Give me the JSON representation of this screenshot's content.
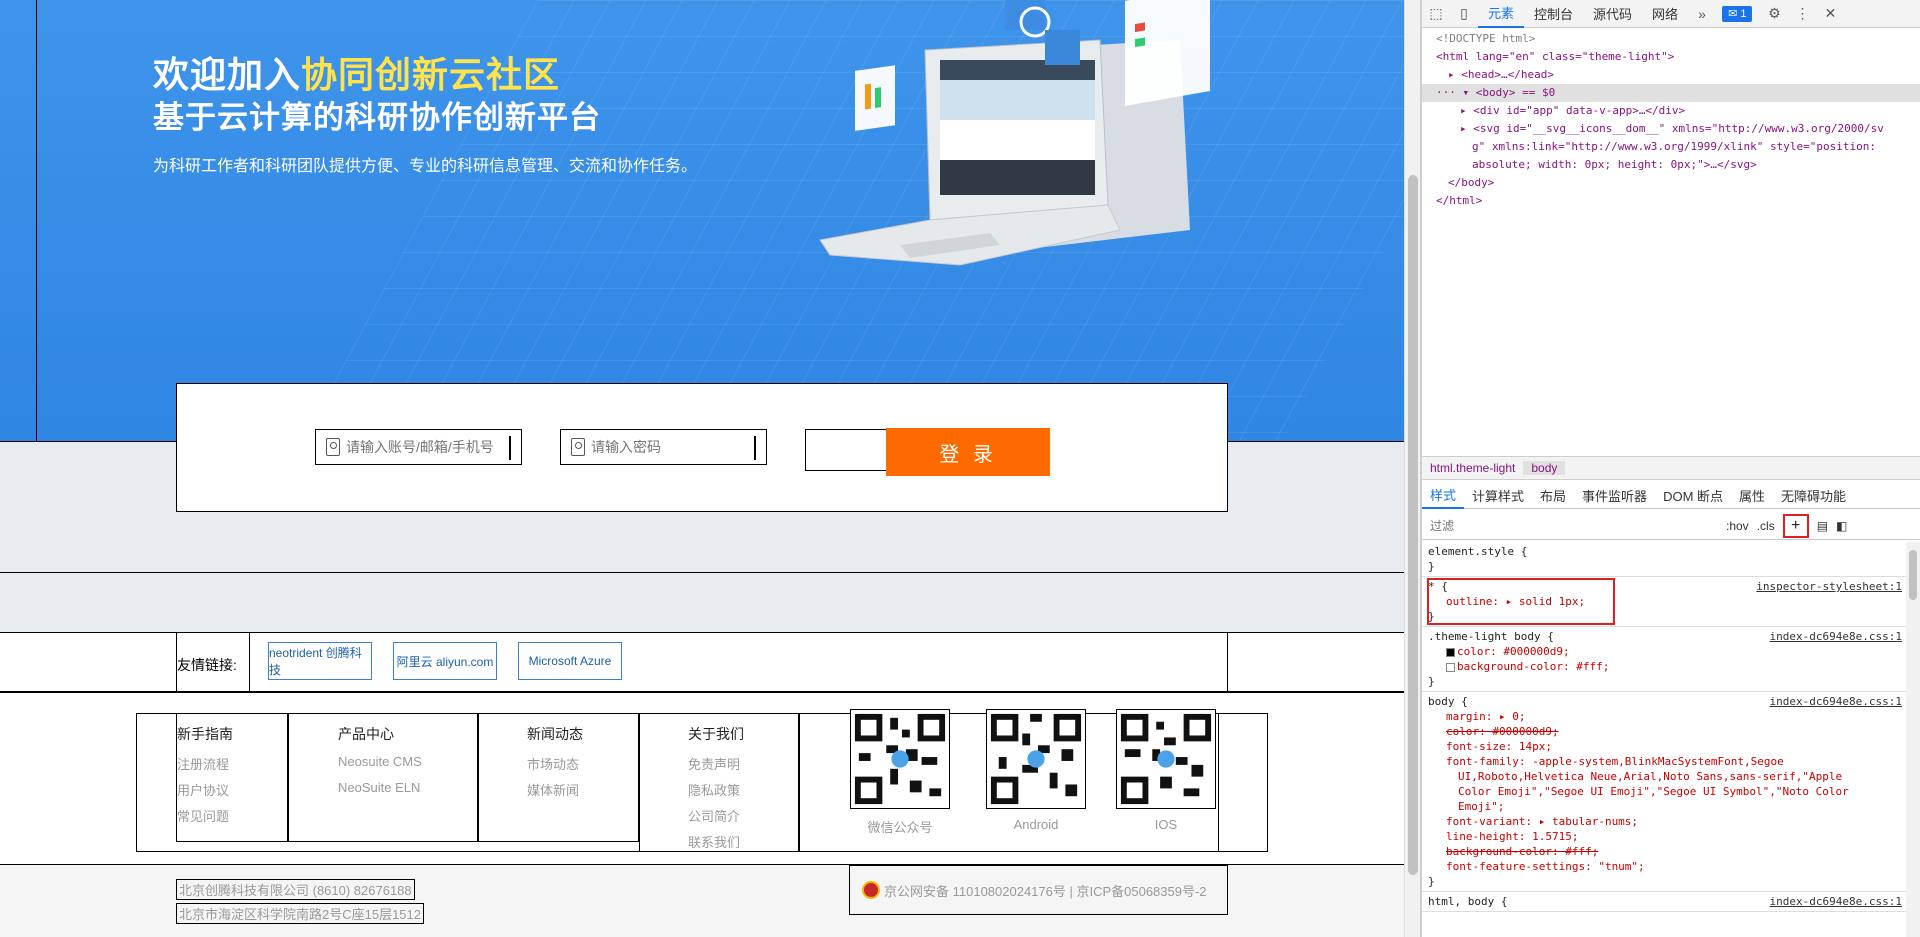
{
  "hero": {
    "title_prefix": "欢迎加入",
    "title_highlight": "协同创新云社区",
    "subtitle": "基于云计算的科研协作创新平台",
    "description": "为科研工作者和科研团队提供方便、专业的科研信息管理、交流和协作任务。"
  },
  "login": {
    "account_placeholder": "请输入账号/邮箱/手机号",
    "password_placeholder": "请输入密码",
    "button_label": "登 录"
  },
  "links": {
    "label": "友情链接:",
    "partners": [
      {
        "name": "neotrident 创腾科技"
      },
      {
        "name": "阿里云 aliyun.com"
      },
      {
        "name": "Microsoft Azure"
      }
    ]
  },
  "footer": {
    "columns": [
      {
        "title": "新手指南",
        "items": [
          "注册流程",
          "用户协议",
          "常见问题"
        ]
      },
      {
        "title": "产品中心",
        "items": [
          "Neosuite CMS",
          "NeoSuite ELN"
        ]
      },
      {
        "title": "新闻动态",
        "items": [
          "市场动态",
          "媒体新闻"
        ]
      },
      {
        "title": "关于我们",
        "items": [
          "免责声明",
          "隐私政策",
          "公司简介",
          "联系我们"
        ]
      }
    ],
    "qr_codes": [
      {
        "caption": "微信公众号"
      },
      {
        "caption": "Android"
      },
      {
        "caption": "IOS"
      }
    ],
    "company": "北京创腾科技有限公司 (8610) 82676188",
    "address": "北京市海淀区科学院南路2号C座15层1512",
    "icp": "京公网安备 11010802024176号 | 京ICP备05068359号-2"
  },
  "devtools": {
    "tabs": [
      "元素",
      "控制台",
      "源代码",
      "网络"
    ],
    "message_count": "1",
    "dom_lines": {
      "doctype": "<!DOCTYPE html>",
      "html_open": "<html lang=\"en\" class=\"theme-light\">",
      "head": "<head>…</head>",
      "body": "<body> == $0",
      "div_app": "<div id=\"app\" data-v-app>…</div>",
      "svg_line1": "<svg id=\"__svg__icons__dom__\" xmlns=\"http://www.w3.org/2000/sv",
      "svg_line2": "g\" xmlns:link=\"http://www.w3.org/1999/xlink\" style=\"position:",
      "svg_line3": "absolute; width: 0px; height: 0px;\">…</svg>",
      "body_close": "</body>",
      "html_close": "</html>"
    },
    "breadcrumb": [
      "html.theme-light",
      "body"
    ],
    "style_tabs": [
      "样式",
      "计算样式",
      "布局",
      "事件监听器",
      "DOM 断点",
      "属性",
      "无障碍功能"
    ],
    "filter_placeholder": "过滤",
    "hov": ":hov",
    "cls": ".cls",
    "rules": {
      "element_style": "element.style {",
      "star_selector": "* {",
      "star_source": "inspector-stylesheet:1",
      "outline": "outline: ▸ solid 1px;",
      "theme_selector": ".theme-light body {",
      "theme_source": "index-dc694e8e.css:1",
      "theme_color": "color: #000000d9;",
      "theme_bg": "background-color: #fff;",
      "body_selector": "body {",
      "body_source": "index-dc694e8e.css:1",
      "margin": "margin: ▸ 0;",
      "color_struck": "color: #000000d9;",
      "font_size": "font-size: 14px;",
      "font_family_1": "font-family: -apple-system,BlinkMacSystemFont,Segoe",
      "font_family_2": "UI,Roboto,Helvetica Neue,Arial,Noto Sans,sans-serif,\"Apple",
      "font_family_3": "Color Emoji\",\"Segoe UI Emoji\",\"Segoe UI Symbol\",\"Noto Color",
      "font_family_4": "Emoji\";",
      "font_variant": "font-variant: ▸ tabular-nums;",
      "line_height": "line-height: 1.5715;",
      "bg_struck": "background-color: #fff;",
      "font_feature": "font-feature-settings: \"tnum\";",
      "html_body_selector": "html, body {",
      "html_body_source": "index-dc694e8e.css:1"
    }
  },
  "colors": {
    "hero_blue": "#3f94ea",
    "login_orange": "#ff6a00",
    "accent_yellow": "#ffe34d",
    "devtools_blue": "#1a73e8"
  }
}
